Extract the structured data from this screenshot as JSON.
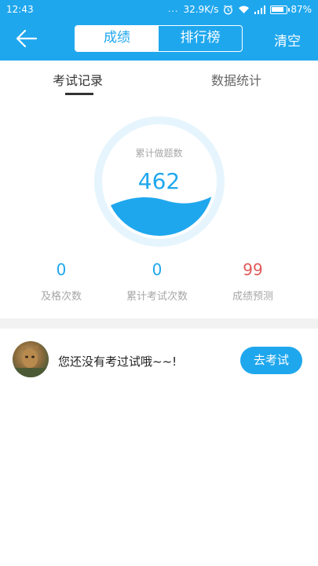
{
  "status_bar": {
    "time": "12:43",
    "dots": "...",
    "network_speed": "32.9K/s",
    "battery_percent": "87%",
    "battery_level": 0.87
  },
  "header": {
    "tabs": [
      {
        "label": "成绩",
        "active": true
      },
      {
        "label": "排行榜",
        "active": false
      }
    ],
    "clear_label": "清空",
    "accent_color": "#1fa7ee"
  },
  "subtabs": [
    {
      "label": "考试记录",
      "active": true
    },
    {
      "label": "数据统计",
      "active": false
    }
  ],
  "gauge": {
    "label": "累计做题数",
    "value": "462"
  },
  "stats": [
    {
      "value": "0",
      "label": "及格次数",
      "color": "#1fa7ee"
    },
    {
      "value": "0",
      "label": "累计考试次数",
      "color": "#1fa7ee"
    },
    {
      "value": "99",
      "label": "成绩预测",
      "color": "#e05a5a"
    }
  ],
  "record": {
    "message": "您还没有考过试哦~~!",
    "button_label": "去考试"
  }
}
